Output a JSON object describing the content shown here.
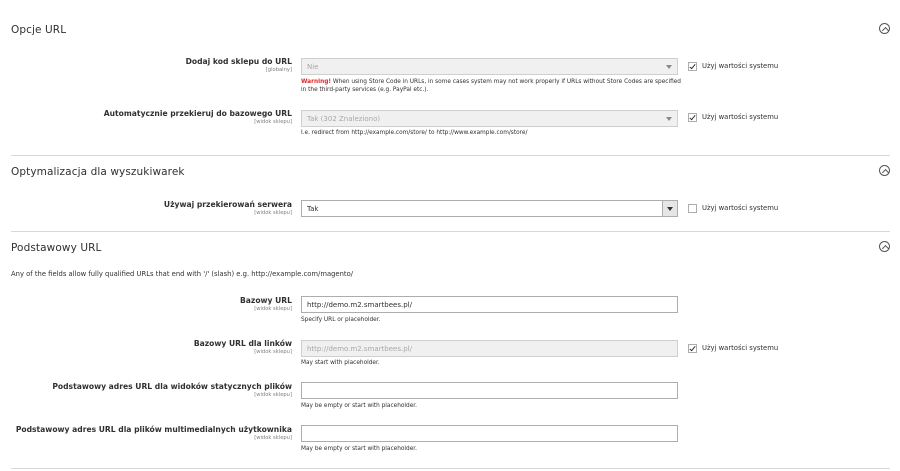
{
  "sections": {
    "opcje_url": {
      "title": "Opcje URL"
    },
    "seo": {
      "title": "Optymalizacja dla wyszukiwarek"
    },
    "base_url": {
      "title": "Podstawowy URL",
      "comment": "Any of the fields allow fully qualified URLs that end with '/' (slash) e.g. http://example.com/magento/"
    }
  },
  "fields": {
    "store_code": {
      "label": "Dodaj kod sklepu do URL",
      "scope": "[globalny]",
      "value": "Nie",
      "note_warning": "Warning!",
      "note_text": " When using Store Code in URLs, in some cases system may not work properly if URLs without Store Codes are specified in the third-party services (e.g. PayPal etc.).",
      "use_system": true
    },
    "auto_redirect": {
      "label": "Automatycznie przekieruj do bazowego URL",
      "scope": "[widok sklepu]",
      "value": "Tak (302 Znaleziono)",
      "note": "I.e. redirect from http://example.com/store/ to http://www.example.com/store/",
      "use_system": true
    },
    "server_rewrites": {
      "label": "Używaj przekierowań serwera",
      "scope": "[widok sklepu]",
      "value": "Tak",
      "use_system": false
    },
    "base_url": {
      "label": "Bazowy URL",
      "scope": "[widok sklepu]",
      "value": "http://demo.m2.smartbees.pl/",
      "note": "Specify URL or placeholder."
    },
    "base_link_url": {
      "label": "Bazowy URL dla linków",
      "scope": "[widok sklepu]",
      "value": "http://demo.m2.smartbees.pl/",
      "note": "May start with placeholder.",
      "use_system": true
    },
    "base_static_url": {
      "label": "Podstawowy adres URL dla widoków statycznych plików",
      "scope": "[widok sklepu]",
      "value": "",
      "note": "May be empty or start with placeholder."
    },
    "base_media_url": {
      "label": "Podstawowy adres URL dla plików multimedialnych użytkownika",
      "scope": "[widok sklepu]",
      "value": "",
      "note": "May be empty or start with placeholder."
    }
  },
  "use_system_label": "Użyj wartości systemu",
  "icons": {
    "collapse": "chevron-up-circle-icon",
    "select": "triangle-down-icon",
    "check": "checkmark-icon"
  }
}
